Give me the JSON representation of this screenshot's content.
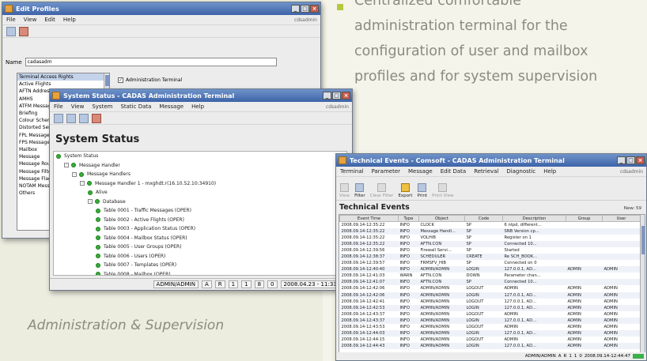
{
  "marketing": {
    "bullet_lines": [
      "Centralized comfortable",
      "administration terminal for the",
      "configuration of user and mailbox",
      "profiles and for system supervision"
    ],
    "caption": "Administration & Supervision",
    "accent_color": "#b6c93e",
    "text_color": "#8b8b80"
  },
  "profiles_window": {
    "title": "Edit Profiles",
    "menu": [
      "File",
      "View",
      "Edit",
      "Help"
    ],
    "user": "cdsadmin",
    "name_label": "Name",
    "name_value": "cadasadm",
    "profile_list": [
      "Terminal Access Rights",
      "Active Flights",
      "AFTN Addressing",
      "AMHS",
      "ATFM Message",
      "Briefing",
      "Colour Scheme",
      "Distorted Serial",
      "FPL Message",
      "FPS Message",
      "Mailbox",
      "Message",
      "Message Routing",
      "Message Filter",
      "Message Flag",
      "NOTAM Message",
      "Others"
    ],
    "selected_index": 0,
    "checkbox_label": "Administration Terminal",
    "checkbox_checked": true
  },
  "status_window": {
    "title": "System Status - CADAS Administration Terminal",
    "menu": [
      "File",
      "View",
      "System",
      "Static Data",
      "Message",
      "Help"
    ],
    "user": "cdsadmin",
    "page_title": "System Status",
    "tree": [
      {
        "label": "System Status",
        "level": 0,
        "toggle": "",
        "dot": true
      },
      {
        "label": "Message Handler",
        "level": 1,
        "toggle": "-",
        "dot": true
      },
      {
        "label": "Message Handlers",
        "level": 2,
        "toggle": "-",
        "dot": true
      },
      {
        "label": "Message Handler 1 - mxghdt.r(16.10.52.10:34910)",
        "level": 3,
        "toggle": "-",
        "dot": true
      },
      {
        "label": "Alive",
        "level": 4,
        "toggle": "",
        "dot": true
      },
      {
        "label": "Database",
        "level": 4,
        "toggle": "-",
        "dot": true
      },
      {
        "label": "Table 0001 - Traffic Messages (OPER)",
        "level": 5,
        "toggle": "",
        "dot": true
      },
      {
        "label": "Table 0002 - Active Flights (OPER)",
        "level": 5,
        "toggle": "",
        "dot": true
      },
      {
        "label": "Table 0003 - Application Status (OPER)",
        "level": 5,
        "toggle": "",
        "dot": true
      },
      {
        "label": "Table 0004 - Mailbox Status (OPER)",
        "level": 5,
        "toggle": "",
        "dot": true
      },
      {
        "label": "Table 0005 - User Groups (OPER)",
        "level": 5,
        "toggle": "",
        "dot": true
      },
      {
        "label": "Table 0006 - Users (OPER)",
        "level": 5,
        "toggle": "",
        "dot": true
      },
      {
        "label": "Table 0007 - Templates (OPER)",
        "level": 5,
        "toggle": "",
        "dot": true
      },
      {
        "label": "Table 0008 - Mailbox (OPER)",
        "level": 5,
        "toggle": "",
        "dot": true
      }
    ],
    "status_items": [
      "ADMIN/ADMIN",
      "A",
      "R",
      "1",
      "1",
      "8",
      "0",
      "2008.04.23 - 11:33:20"
    ]
  },
  "events_window": {
    "title": "Technical Events - Comsoft - CADAS Administration Terminal",
    "menu": [
      "Terminal",
      "Parameter",
      "Message",
      "Edit Data",
      "Retrieval",
      "Diagnostic",
      "Help"
    ],
    "user": "cdsadmin",
    "buttons": [
      {
        "label": "View",
        "enabled": false
      },
      {
        "label": "Filter",
        "enabled": true
      },
      {
        "label": "Clear Filter",
        "enabled": false
      },
      {
        "label": "Export",
        "enabled": true
      },
      {
        "label": "Print",
        "enabled": true
      },
      {
        "label": "Print View",
        "enabled": false
      }
    ],
    "page_title": "Technical Events",
    "new_label": "New: 59",
    "columns": [
      "Event Time",
      "Type",
      "Object",
      "Code",
      "Description",
      "Group",
      "User"
    ],
    "rows": [
      [
        "2008.09.14-12:35:22",
        "INFO",
        "CLOCK",
        "SP",
        "6 ntpd, different...",
        "",
        ""
      ],
      [
        "2008.09.14-12:35:22",
        "INFO",
        "Message Handl...",
        "SP",
        "SNB Version cp...",
        "",
        ""
      ],
      [
        "2008.09.14-12:35:22",
        "INFO",
        "VOLHIB",
        "SP",
        "Register on 1",
        "",
        ""
      ],
      [
        "2008.09.14-12:35:22",
        "INFO",
        "AFTN.CON",
        "SP",
        "Connected 10...",
        "",
        ""
      ],
      [
        "2008.09.14-12:39:56",
        "INFO",
        "Firewall Servi...",
        "SP",
        "Started",
        "",
        ""
      ],
      [
        "2008.09.14-12:38:37",
        "INFO",
        "SCHEDULER",
        "CREATE",
        "Re SCH_BOOK...",
        "",
        ""
      ],
      [
        "2008.09.14-12:39:57",
        "INFO",
        "FRMSFV_HIB",
        "SP",
        "Connected on 0",
        "",
        ""
      ],
      [
        "2008.09.14-12:40:40",
        "INFO",
        "ADMIN/ADMIN",
        "LOGIN",
        "127.0.0.1, AD...",
        "ADMIN",
        "ADMIN"
      ],
      [
        "2008.09.14-12:41:03",
        "WARN",
        "AFTN.CON",
        "DOWN",
        "Parameter chan...",
        "",
        ""
      ],
      [
        "2008.09.14-12:41:07",
        "INFO",
        "AFTN.CON",
        "SP",
        "Connected 10...",
        "",
        ""
      ],
      [
        "2008.09.14-12:42:06",
        "INFO",
        "ADMIN/ADMIN",
        "LOGOUT",
        "ADMIN",
        "ADMIN",
        "ADMIN"
      ],
      [
        "2008.09.14-12:42:06",
        "INFO",
        "ADMIN/ADMIN",
        "LOGIN",
        "127.0.0.1, AD...",
        "ADMIN",
        "ADMIN"
      ],
      [
        "2008.09.14-12:42:41",
        "INFO",
        "ADMIN/ADMIN",
        "LOGOUT",
        "127.0.0.1, AD...",
        "ADMIN",
        "ADMIN"
      ],
      [
        "2008.09.14-12:42:53",
        "INFO",
        "ADMIN/ADMIN",
        "LOGIN",
        "127.0.0.1, AD...",
        "ADMIN",
        "ADMIN"
      ],
      [
        "2008.09.14-12:43:37",
        "INFO",
        "ADMIN/ADMIN",
        "LOGOUT",
        "ADMIN",
        "ADMIN",
        "ADMIN"
      ],
      [
        "2008.09.14-12:43:37",
        "INFO",
        "ADMIN/ADMIN",
        "LOGIN",
        "127.0.0.1, AD...",
        "ADMIN",
        "ADMIN"
      ],
      [
        "2008.09.14-12:43:53",
        "INFO",
        "ADMIN/ADMIN",
        "LOGOUT",
        "ADMIN",
        "ADMIN",
        "ADMIN"
      ],
      [
        "2008.09.14-12:44:03",
        "INFO",
        "ADMIN/ADMIN",
        "LOGIN",
        "127.0.0.1, AD...",
        "ADMIN",
        "ADMIN"
      ],
      [
        "2008.09.14-12:44:15",
        "INFO",
        "ADMIN/ADMIN",
        "LOGOUT",
        "ADMIN",
        "ADMIN",
        "ADMIN"
      ],
      [
        "2008.09.14-12:44:43",
        "INFO",
        "ADMIN/ADMIN",
        "LOGIN",
        "127.0.0.1, AD...",
        "ADMIN",
        "ADMIN"
      ]
    ],
    "status_items": [
      "ADMIN/ADMIN",
      "A",
      "R",
      "1",
      "1",
      "0",
      "2008.09.14-12:44:47"
    ]
  }
}
